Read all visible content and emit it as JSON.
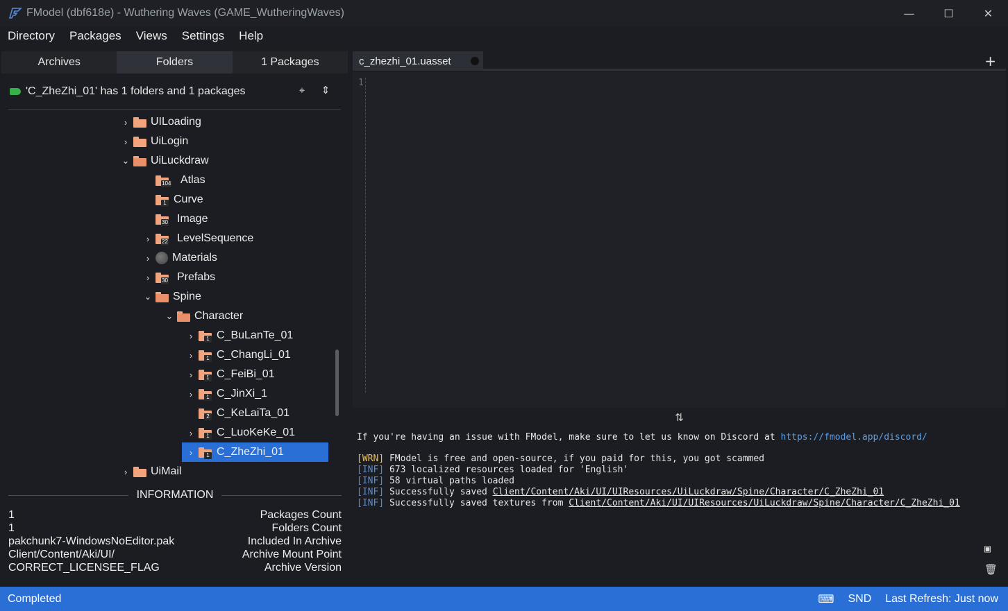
{
  "window": {
    "title": "FModel (dbf618e) - Wuthering Waves (GAME_WutheringWaves)",
    "minimize": "—",
    "maximize": "☐",
    "close": "✕"
  },
  "menu": [
    "Directory",
    "Packages",
    "Views",
    "Settings",
    "Help"
  ],
  "left_tabs": [
    "Archives",
    "Folders",
    "1 Packages"
  ],
  "active_left_tab": "Folders",
  "status": {
    "text": "'C_ZheZhi_01' has 1 folders and 1 packages",
    "locate_icon": "⌖",
    "collapse_icon": "⇕"
  },
  "tree": [
    {
      "label": "UILoading",
      "chev": "›",
      "badge": "",
      "type": "folder"
    },
    {
      "label": "UiLogin",
      "chev": "›",
      "badge": "",
      "type": "folder"
    },
    {
      "label": "UiLuckdraw",
      "chev": "⌄",
      "badge": "",
      "type": "folder"
    },
    {
      "label": "Atlas",
      "chev": "",
      "badge": "104",
      "type": "folder"
    },
    {
      "label": "Curve",
      "chev": "",
      "badge": "1",
      "type": "folder"
    },
    {
      "label": "Image",
      "chev": "",
      "badge": "30",
      "type": "folder"
    },
    {
      "label": "LevelSequence",
      "chev": "›",
      "badge": "22",
      "type": "folder"
    },
    {
      "label": "Materials",
      "chev": "›",
      "badge": "",
      "type": "material"
    },
    {
      "label": "Prefabs",
      "chev": "›",
      "badge": "30",
      "type": "folder"
    },
    {
      "label": "Spine",
      "chev": "⌄",
      "badge": "",
      "type": "folder"
    },
    {
      "label": "Character",
      "chev": "⌄",
      "badge": "",
      "type": "folder"
    },
    {
      "label": "C_BuLanTe_01",
      "chev": "›",
      "badge": "1",
      "type": "folder"
    },
    {
      "label": "C_ChangLi_01",
      "chev": "›",
      "badge": "1",
      "type": "folder"
    },
    {
      "label": "C_FeiBi_01",
      "chev": "›",
      "badge": "1",
      "type": "folder"
    },
    {
      "label": "C_JinXi_1",
      "chev": "›",
      "badge": "1",
      "type": "folder"
    },
    {
      "label": "C_KeLaiTa_01",
      "chev": "",
      "badge": "2",
      "type": "folder"
    },
    {
      "label": "C_LuoKeKe_01",
      "chev": "›",
      "badge": "1",
      "type": "folder"
    },
    {
      "label": "C_ZheZhi_01",
      "chev": "›",
      "badge": "1",
      "type": "folder",
      "selected": true
    },
    {
      "label": "UiMail",
      "chev": "›",
      "badge": "",
      "type": "folder"
    }
  ],
  "information": {
    "heading": "INFORMATION",
    "rows": [
      {
        "value": "1",
        "key": "Packages Count"
      },
      {
        "value": "1",
        "key": "Folders Count"
      },
      {
        "value": "pakchunk7-WindowsNoEditor.pak",
        "key": "Included In Archive"
      },
      {
        "value": "Client/Content/Aki/UI/",
        "key": "Archive Mount Point"
      },
      {
        "value": "CORRECT_LICENSEE_FLAG",
        "key": "Archive Version"
      }
    ]
  },
  "doc_tab": {
    "label": "c_zhezhi_01.uasset",
    "add": "+"
  },
  "editor": {
    "line_number": "1"
  },
  "splitter_icon": "⇅",
  "log": {
    "intro_text": "If you're having an issue with FModel, make sure to let us know on Discord at ",
    "intro_link": "https://fmodel.app/discord/",
    "lines": [
      {
        "level": "[WRN]",
        "text": " FModel is free and open-source, if you paid for this, you got scammed",
        "link": ""
      },
      {
        "level": "[INF]",
        "text": " 673 localized resources loaded for 'English'",
        "link": ""
      },
      {
        "level": "[INF]",
        "text": " 58 virtual paths loaded",
        "link": ""
      },
      {
        "level": "[INF]",
        "text": " Successfully saved ",
        "link": "Client/Content/Aki/UI/UIResources/UiLuckdraw/Spine/Character/C_ZheZhi_01"
      },
      {
        "level": "[INF]",
        "text": " Successfully saved textures from ",
        "link": "Client/Content/Aki/UI/UIResources/UiLuckdraw/Spine/Character/C_ZheZhi_01"
      }
    ],
    "folder_icon": "▣",
    "clear_icon": "🗑"
  },
  "statusbar": {
    "left": "Completed",
    "snd": "SND",
    "refresh": "Last Refresh: Just now",
    "keyboard_icon": "⌨"
  },
  "colors": {
    "accent": "#2a6fd6",
    "folder": "#f1a47e",
    "warn": "#e8c060",
    "info": "#5a8ad6",
    "tag": "#35b04a"
  }
}
